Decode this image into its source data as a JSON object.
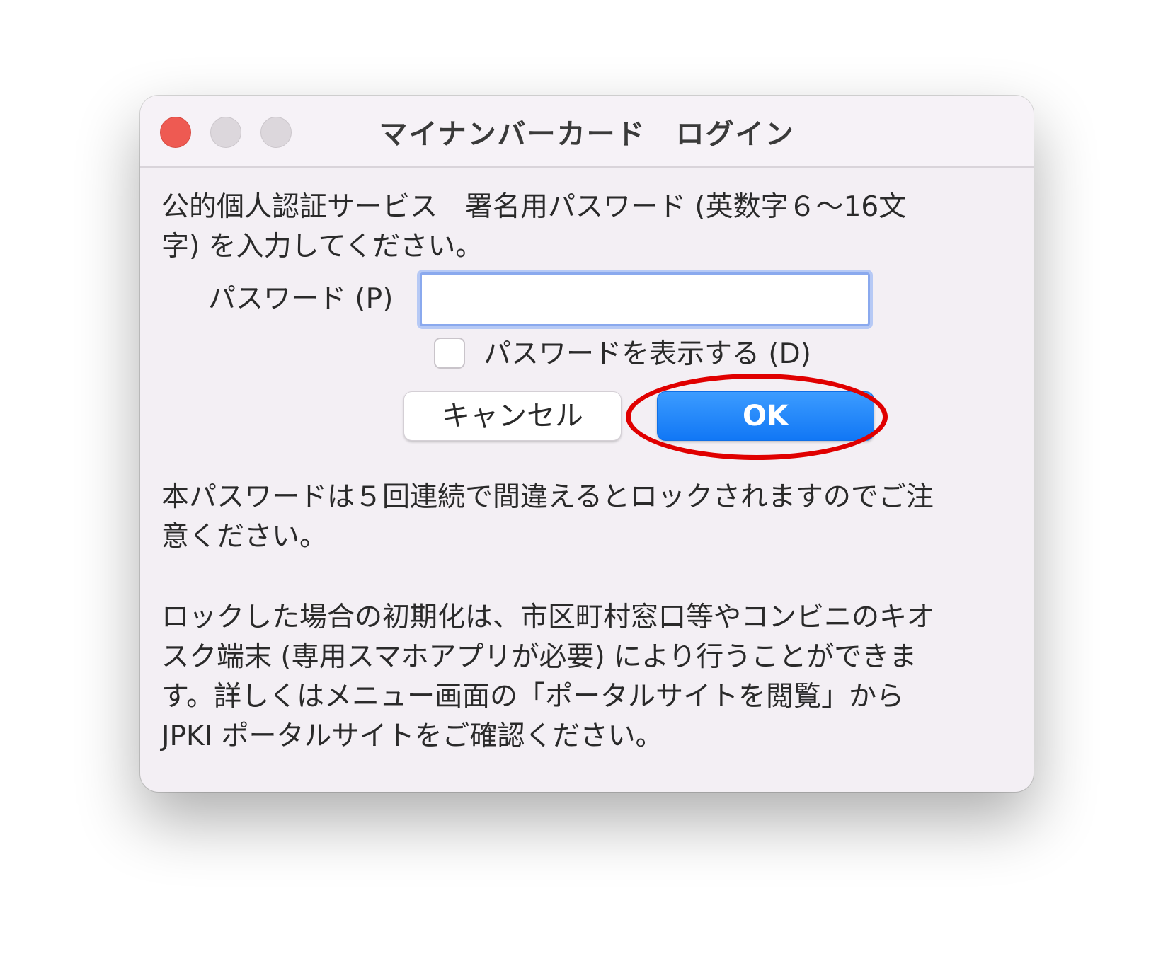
{
  "window": {
    "title": "マイナンバーカード　ログイン"
  },
  "instruction": "公的個人認証サービス　署名用パスワード (英数字６〜16文\n字) を入力してください。",
  "password": {
    "label": "パスワード (P)",
    "value": ""
  },
  "show_password": {
    "label": "パスワードを表示する (D)",
    "checked": false
  },
  "buttons": {
    "cancel": "キャンセル",
    "ok": "OK"
  },
  "notes": {
    "lock_warning": "本パスワードは５回連続で間違えるとロックされますのでご注\n意ください。",
    "reset_info": "ロックした場合の初期化は、市区町村窓口等やコンビニのキオ\nスク端末 (専用スマホアプリが必要) により行うことができま\nす。詳しくはメニュー画面の「ポータルサイトを閲覧」から\nJPKI ポータルサイトをご確認ください。"
  },
  "colors": {
    "close": "#ee5a52",
    "accent": "#1177f5",
    "highlight": "#e00000"
  }
}
